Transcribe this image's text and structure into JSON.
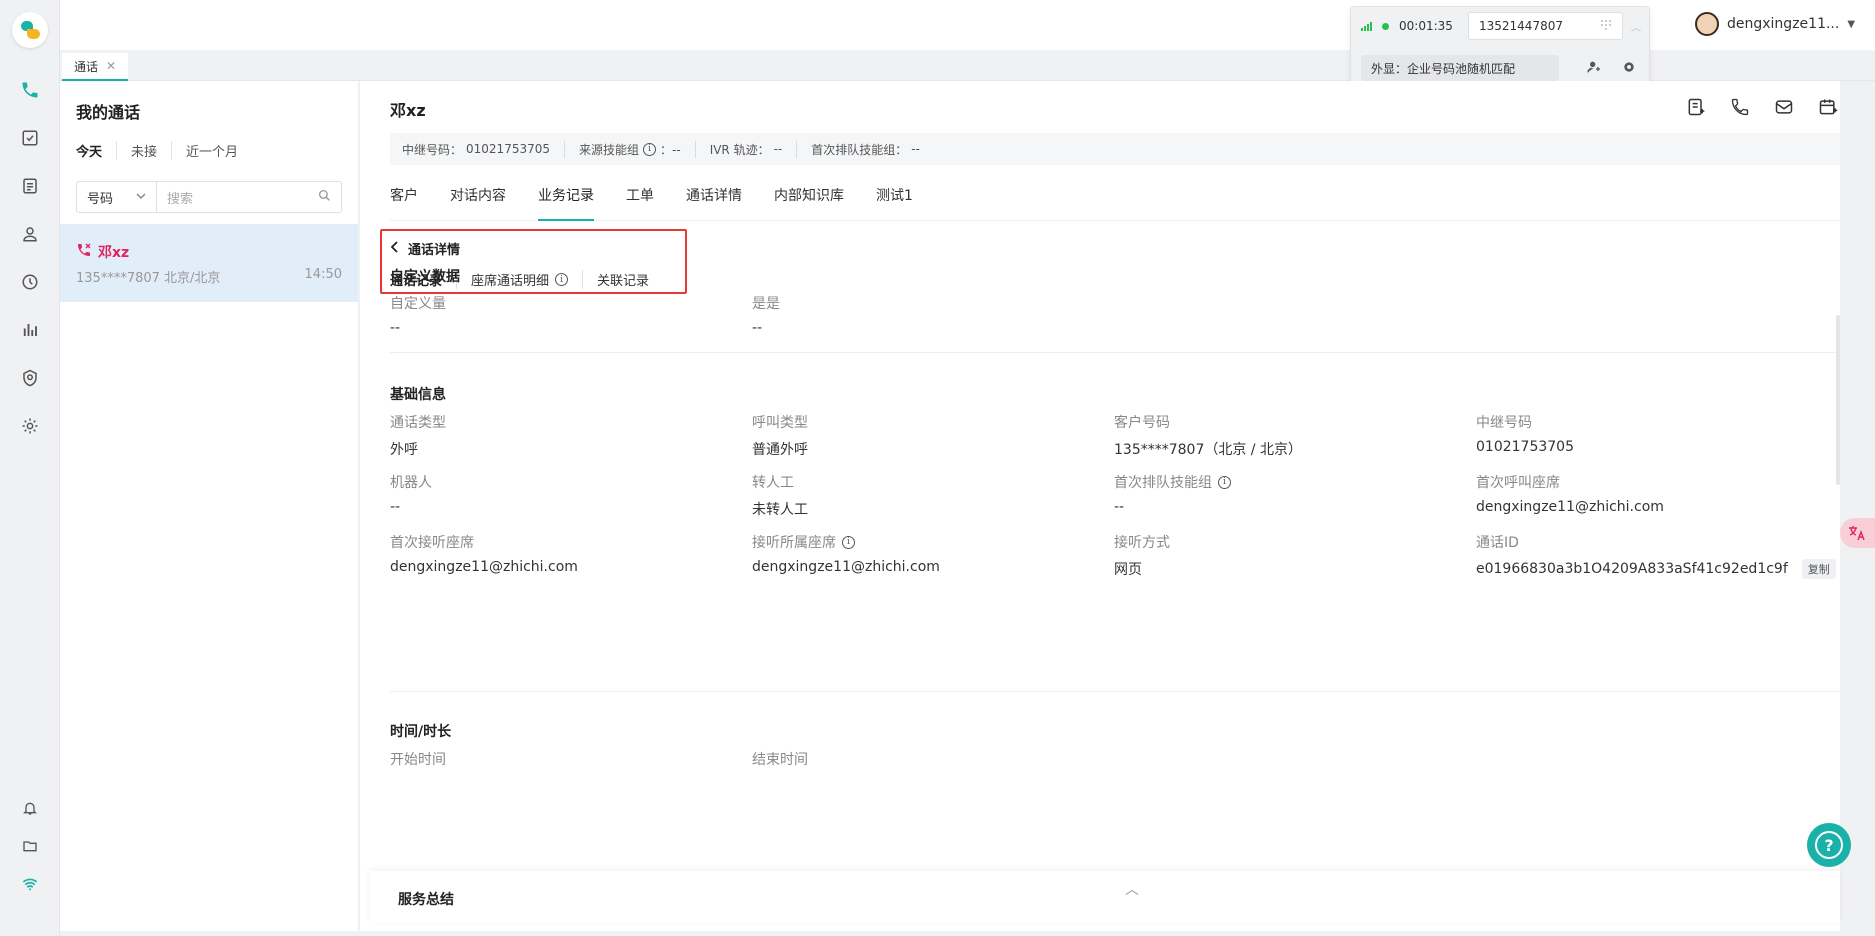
{
  "tab": {
    "label": "通话"
  },
  "call_widget": {
    "timer": "00:01:35",
    "phone_value": "13521447807",
    "outbound_display": "外显：企业号码池随机匹配"
  },
  "user": {
    "name": "dengxingze11..."
  },
  "list_panel": {
    "title": "我的通话",
    "filters": [
      "今天",
      "未接",
      "近一个月"
    ],
    "search_type": "号码",
    "search_placeholder": "搜索",
    "items": [
      {
        "name": "邓xz",
        "sub": "135****7807 北京/北京",
        "time": "14:50"
      }
    ]
  },
  "main": {
    "contact_name": "邓xz",
    "info_bar": {
      "trunk_label": "中继号码：",
      "trunk_value": "01021753705",
      "source_skill_label": "来源技能组",
      "source_skill_value": "：--",
      "ivr_label": "IVR 轨迹：",
      "ivr_value": "--",
      "first_queue_label": "首次排队技能组：",
      "first_queue_value": "--"
    },
    "tabs": [
      "客户",
      "对话内容",
      "业务记录",
      "工单",
      "通话详情",
      "内部知识库",
      "测试1"
    ],
    "active_tab": "业务记录",
    "detail_title": "通话详情",
    "sub_tabs": [
      "通话记录",
      "座席通话明细",
      "关联记录"
    ],
    "sections": {
      "custom": {
        "title": "自定义数据",
        "fields": [
          {
            "label": "自定义量",
            "value": "--"
          },
          {
            "label": "是是",
            "value": "--"
          }
        ]
      },
      "basic": {
        "title": "基础信息",
        "fields": [
          {
            "label": "通话类型",
            "value": "外呼"
          },
          {
            "label": "呼叫类型",
            "value": "普通外呼"
          },
          {
            "label": "客户号码",
            "value": "135****7807（北京 / 北京）"
          },
          {
            "label": "中继号码",
            "value": "01021753705"
          },
          {
            "label": "机器人",
            "value": "--"
          },
          {
            "label": "转人工",
            "value": "未转人工"
          },
          {
            "label": "首次排队技能组",
            "value": "--"
          },
          {
            "label": "首次呼叫座席",
            "value": "dengxingze11@zhichi.com"
          },
          {
            "label": "首次接听座席",
            "value": "dengxingze11@zhichi.com"
          },
          {
            "label": "接听所属座席",
            "value": "dengxingze11@zhichi.com"
          },
          {
            "label": "接听方式",
            "value": "网页"
          },
          {
            "label": "通话ID",
            "value": "e01966830a3b1O4209A833aSf41c92ed1c9f"
          }
        ],
        "copy_label": "复制"
      },
      "time": {
        "title": "时间/时长",
        "fields": [
          {
            "label": "开始时间",
            "value": ""
          },
          {
            "label": "结束时间",
            "value": ""
          }
        ]
      }
    },
    "footer_title": "服务总结"
  },
  "colors": {
    "accent": "#1ab1a8",
    "missed": "#e0245e",
    "highlight_border": "#e53935",
    "selected_bg": "#e2edfa"
  },
  "icons": [
    "phone-icon",
    "task-icon",
    "document-icon",
    "contacts-icon",
    "history-icon",
    "stats-icon",
    "security-icon",
    "settings-icon",
    "bell-icon",
    "folder-icon",
    "wifi-icon",
    "search-icon",
    "missed-call-icon",
    "add-note-icon",
    "call-icon",
    "mail-icon",
    "calendar-add-icon",
    "dialpad-icon",
    "transfer-icon",
    "gear-icon",
    "back-icon",
    "info-icon",
    "help-icon",
    "translate-icon"
  ]
}
